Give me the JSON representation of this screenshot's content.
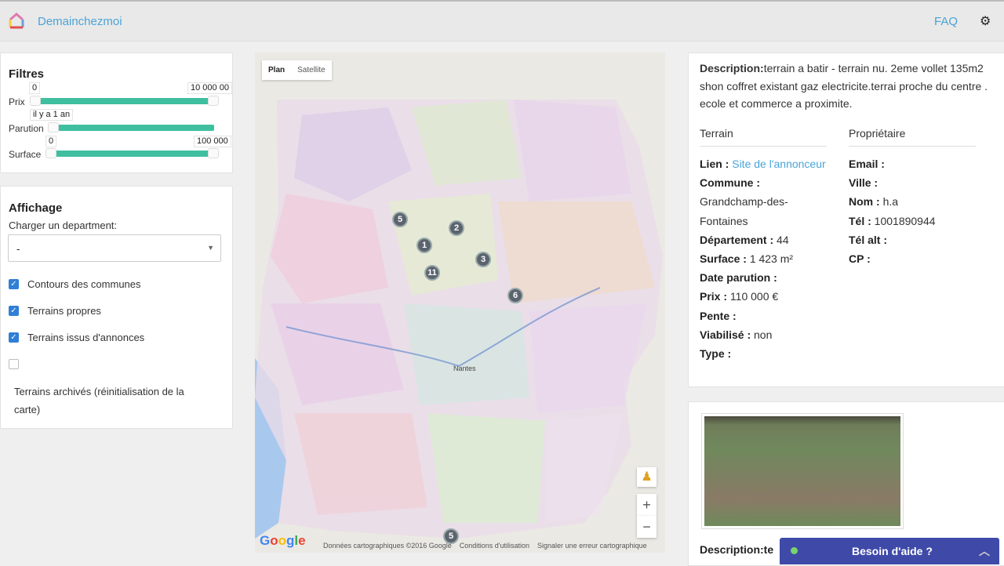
{
  "header": {
    "brand": "Demainchezmoi",
    "faq": "FAQ",
    "settings_icon": "gear-icon"
  },
  "filters": {
    "title": "Filtres",
    "prix": {
      "label": "Prix",
      "min": "0",
      "max": "10 000 00"
    },
    "parution": {
      "label": "Parution",
      "value": "il y a 1 an"
    },
    "surface": {
      "label": "Surface",
      "min": "0",
      "max": "100 000"
    }
  },
  "affichage": {
    "title": "Affichage",
    "dept_label": "Charger un department:",
    "dept_value": "-",
    "checkboxes": [
      {
        "label": "Contours des communes",
        "checked": true
      },
      {
        "label": "Terrains propres",
        "checked": true
      },
      {
        "label": "Terrains issus d'annonces",
        "checked": true
      },
      {
        "label": "Terrains archivés (réinitialisation de la carte)",
        "checked": false
      }
    ]
  },
  "map": {
    "tabs": [
      "Plan",
      "Satellite"
    ],
    "active_tab": "Plan",
    "city": "Nantes",
    "markers": [
      "5",
      "2",
      "1",
      "3",
      "11",
      "6",
      "5"
    ],
    "zoom_in": "+",
    "zoom_out": "−",
    "logo": "Google",
    "attribution": [
      "Données cartographiques ©2016 Google",
      "Conditions d'utilisation",
      "Signaler une erreur cartographique"
    ]
  },
  "info": {
    "description_label": "Description:",
    "description": "terrain a batir - terrain nu. 2eme vollet 135m2 shon coffret existant gaz electricite.terrai proche du centre . ecole et commerce a proximite.",
    "terrain": {
      "title": "Terrain",
      "lien_label": "Lien :",
      "lien_text": "Site de l'annonceur",
      "commune_label": "Commune :",
      "commune": "Grandchamp-des-Fontaines",
      "dept_label": "Département :",
      "dept": "44",
      "surface_label": "Surface :",
      "surface": "1 423 m²",
      "date_label": "Date parution :",
      "prix_label": "Prix :",
      "prix": "110 000 €",
      "pente_label": "Pente :",
      "viab_label": "Viabilisé :",
      "viab": "non",
      "type_label": "Type :"
    },
    "proprietaire": {
      "title": "Propriétaire",
      "email_label": "Email :",
      "ville_label": "Ville :",
      "nom_label": "Nom :",
      "nom": "h.a",
      "tel_label": "Tél :",
      "tel": "1001890944",
      "telalt_label": "Tél alt :",
      "cp_label": "CP :"
    }
  },
  "photo": {
    "description_label": "Description:te"
  },
  "help": {
    "label": "Besoin d'aide ?"
  }
}
